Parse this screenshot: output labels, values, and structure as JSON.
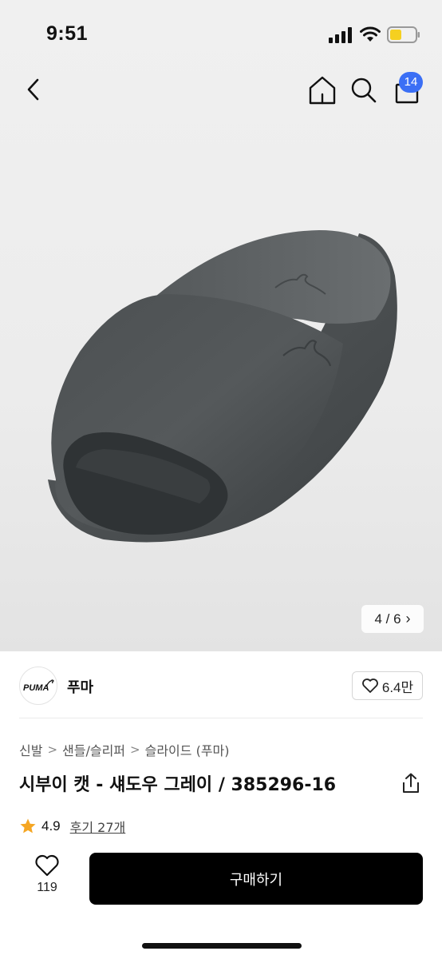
{
  "status_bar": {
    "time": "9:51"
  },
  "nav": {
    "cart_badge": "14"
  },
  "gallery": {
    "counter": "4 / 6"
  },
  "brand": {
    "logo_text": "PUMA",
    "name": "푸마",
    "like_count": "6.4만"
  },
  "breadcrumb": {
    "items": [
      "신발",
      "샌들/슬리퍼",
      "슬라이드 (푸마)"
    ]
  },
  "product": {
    "title": "시부이 캣 - 섀도우 그레이 / 385296-16",
    "rating": "4.9",
    "review_link": "후기 27개"
  },
  "bottom_bar": {
    "wish_count": "119",
    "buy_label": "구매하기"
  },
  "colors": {
    "accent_badge": "#3b6ff5",
    "buy_button": "#000000",
    "star": "#f5a623"
  }
}
